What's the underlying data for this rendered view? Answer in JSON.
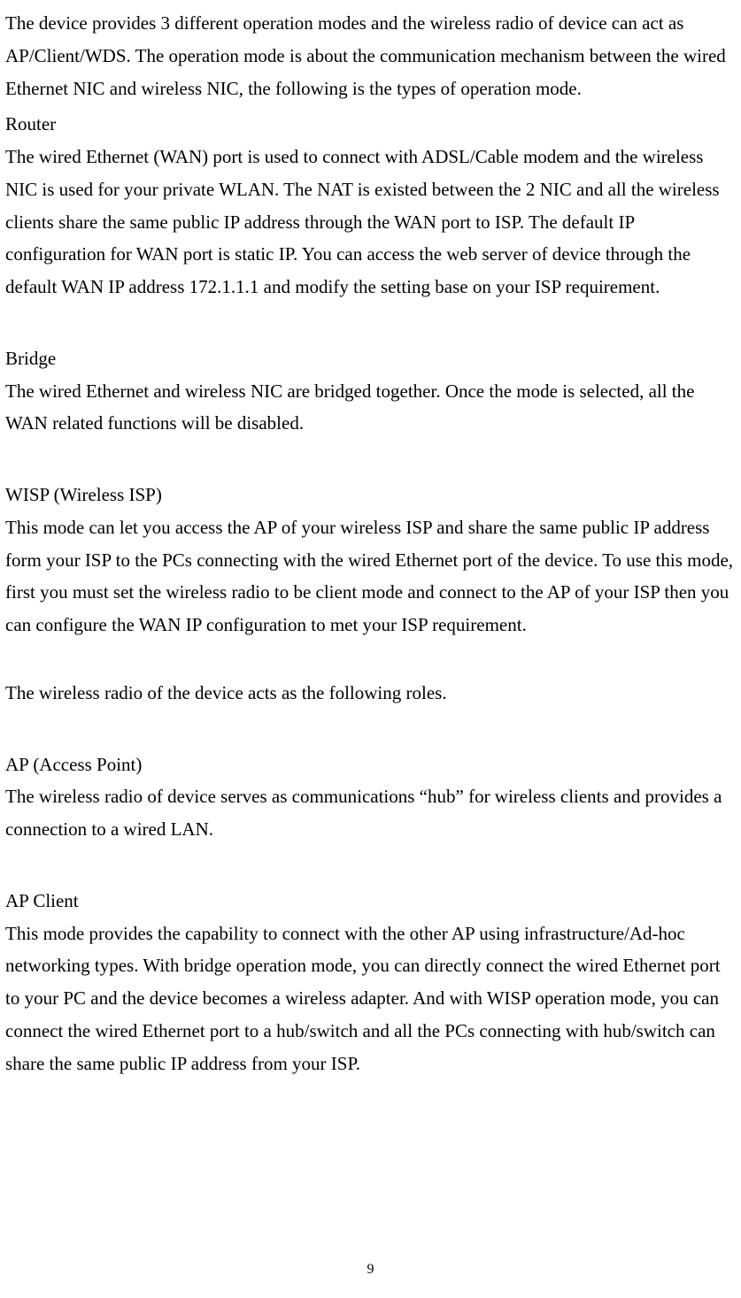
{
  "intro": "The device provides 3 different operation modes and the wireless radio of device can act as AP/Client/WDS. The operation mode is about the communication mechanism between the wired Ethernet NIC and wireless NIC, the following is the types of operation mode.",
  "sections": {
    "router": {
      "heading": "Router",
      "body": "The wired Ethernet (WAN) port is used to connect with ADSL/Cable modem and the wireless NIC is used for your private WLAN. The NAT is existed between the 2 NIC and all the wireless clients share the same public IP address through the WAN port to ISP. The default IP configuration for WAN port is static IP. You can access the web server of device through the default WAN IP address 172.1.1.1 and modify the setting base on your ISP requirement."
    },
    "bridge": {
      "heading": "Bridge",
      "body": "The wired Ethernet and wireless NIC are bridged together. Once the mode is selected, all the WAN related functions will be disabled."
    },
    "wisp": {
      "heading": "WISP (Wireless ISP)",
      "body": "This mode can let you access the AP of your wireless ISP and share the same public IP address form your ISP to the PCs connecting with the wired Ethernet port of the device. To use this mode, first you must set the wireless radio to be client mode and connect to the AP of your ISP then you can configure the WAN IP configuration to met your ISP requirement."
    },
    "roles_intro": "The wireless radio of the device acts as the following roles.",
    "ap": {
      "heading": "AP (Access Point)",
      "body": "The wireless radio of device serves as communications “hub” for wireless clients and provides a connection to a wired LAN."
    },
    "ap_client": {
      "heading": "AP Client",
      "body": "This mode provides the capability to connect with the other AP using infrastructure/Ad-hoc networking types. With bridge operation mode, you can directly connect the wired Ethernet port to your PC and the device becomes a wireless adapter. And with WISP operation mode, you can connect the wired Ethernet port to a hub/switch and all the PCs connecting with hub/switch can share the same public IP address from your ISP."
    }
  },
  "page_number": "9"
}
